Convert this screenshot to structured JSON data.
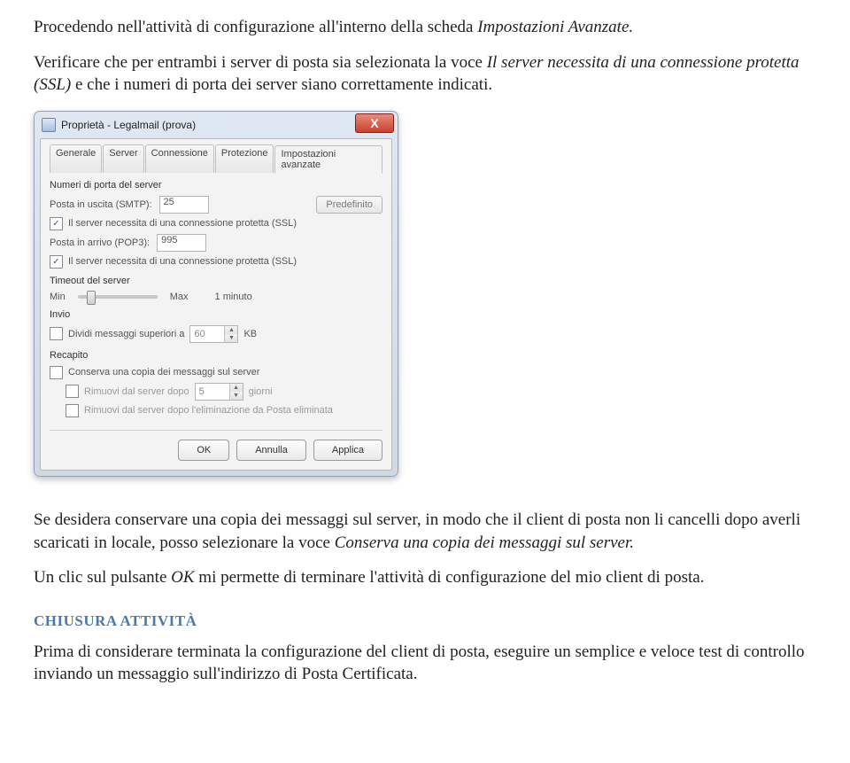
{
  "paragraphs": {
    "p1_a": "Procedendo nell'attività di configurazione all'interno della scheda ",
    "p1_b": "Impostazioni Avanzate.",
    "p2_a": "Verificare che per entrambi i server di posta sia selezionata la voce ",
    "p2_b": "Il server necessita di una connessione protetta (SSL) ",
    "p2_c": "e che i numeri di porta dei server siano correttamente indicati.",
    "p3_a": "Se desidera conservare una copia dei messaggi sul server, in modo che il client di posta non li cancelli dopo averli scaricati in locale, posso selezionare la voce ",
    "p3_b": "Conserva una copia dei messaggi sul server.",
    "p4_a": "Un clic sul pulsante ",
    "p4_b": "OK",
    "p4_c": " mi permette di terminare l'attività di configurazione del mio client di posta.",
    "heading": "CHIUSURA ATTIVITÀ",
    "p5": "Prima di considerare terminata la configurazione del client di posta, eseguire un semplice e veloce test di controllo inviando un messaggio sull'indirizzo di Posta Certificata."
  },
  "dialog": {
    "title": "Proprietà - Legalmail (prova)",
    "close": "X",
    "tabs": [
      "Generale",
      "Server",
      "Connessione",
      "Protezione",
      "Impostazioni avanzate"
    ],
    "group_ports": "Numeri di porta del server",
    "smtp_label": "Posta in uscita (SMTP):",
    "smtp_value": "25",
    "default_btn": "Predefinito",
    "ssl_out": "Il server necessita di una connessione protetta (SSL)",
    "pop_label": "Posta in arrivo (POP3):",
    "pop_value": "995",
    "ssl_in": "Il server necessita di una connessione protetta (SSL)",
    "group_timeout": "Timeout del server",
    "timeout_min": "Min",
    "timeout_max": "Max",
    "timeout_val": "1 minuto",
    "group_send": "Invio",
    "split_label": "Dividi messaggi superiori a",
    "split_value": "60",
    "split_unit": "KB",
    "group_delivery": "Recapito",
    "keep_copy": "Conserva una copia dei messaggi sul server",
    "remove_after": "Rimuovi dal server dopo",
    "remove_after_val": "5",
    "remove_after_unit": "giorni",
    "remove_deleted": "Rimuovi dal server dopo l'eliminazione da Posta eliminata",
    "btn_ok": "OK",
    "btn_cancel": "Annulla",
    "btn_apply": "Applica"
  }
}
